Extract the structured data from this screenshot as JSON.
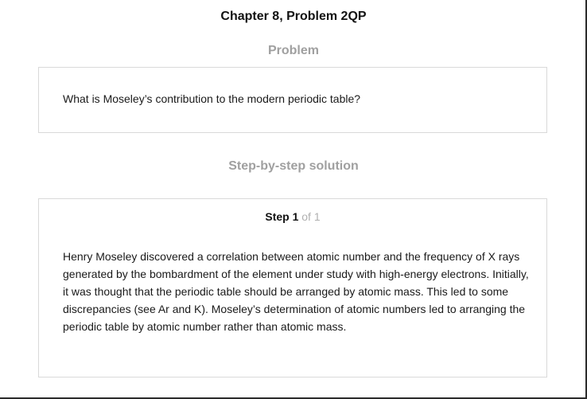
{
  "chapter_title": "Chapter 8, Problem 2QP",
  "problem": {
    "heading": "Problem",
    "text": "What is Moseley’s contribution to the modern periodic table?"
  },
  "solution": {
    "heading": "Step-by-step solution",
    "step_label": "Step 1",
    "step_of": "of 1",
    "text": "Henry Moseley discovered a correlation between atomic number and the frequency of X rays generated by the bombardment of the element under study with high-energy electrons. Initially, it was thought that the periodic table should be arranged by atomic mass. This led to some discrepancies (see Ar and K). Moseley’s determination of atomic numbers led to arranging the periodic table by atomic number rather than atomic mass."
  }
}
